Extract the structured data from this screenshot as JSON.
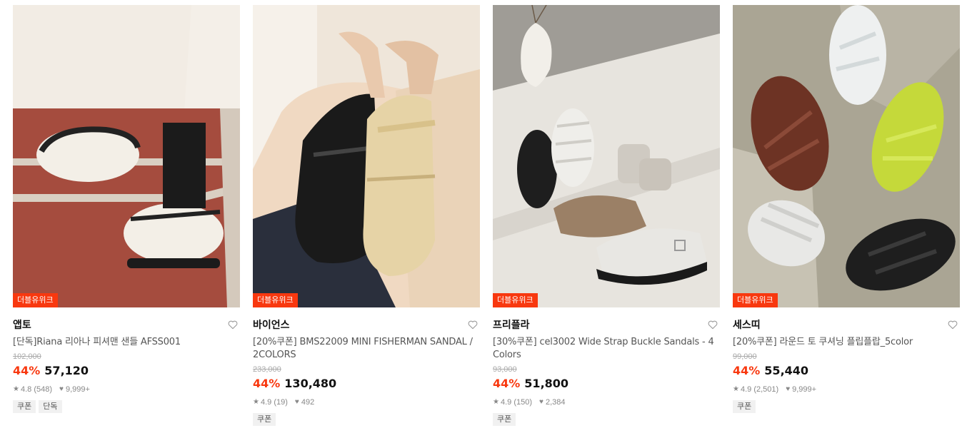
{
  "products": [
    {
      "badge": "더블유위크",
      "brand": "앱토",
      "name": "[단독]Riana 리아나 피셔맨 샌들 AFSS001",
      "original_price": "102,000",
      "discount": "44%",
      "price": "57,120",
      "rating": "4.8",
      "reviews": "(548)",
      "likes": "9,999+",
      "tags": [
        "쿠폰",
        "단독"
      ]
    },
    {
      "badge": "더블유위크",
      "brand": "바이언스",
      "name": "[20%쿠폰] BMS22009 MINI FISHERMAN SANDAL / 2COLORS",
      "original_price": "233,000",
      "discount": "44%",
      "price": "130,480",
      "rating": "4.9",
      "reviews": "(19)",
      "likes": "492",
      "tags": [
        "쿠폰"
      ]
    },
    {
      "badge": "더블유위크",
      "brand": "프리플라",
      "name": "[30%쿠폰] cel3002 Wide Strap Buckle Sandals - 4 Colors",
      "original_price": "93,000",
      "discount": "44%",
      "price": "51,800",
      "rating": "4.9",
      "reviews": "(150)",
      "likes": "2,384",
      "tags": [
        "쿠폰"
      ]
    },
    {
      "badge": "더블유위크",
      "brand": "세스띠",
      "name": "[20%쿠폰] 라운드 토 쿠셔닝 플립플랍_5color",
      "original_price": "99,000",
      "discount": "44%",
      "price": "55,440",
      "rating": "4.9",
      "reviews": "(2,501)",
      "likes": "9,999+",
      "tags": [
        "쿠폰"
      ]
    }
  ],
  "icons": {
    "wish": "heart-outline-icon",
    "rating": "star-icon",
    "likes": "heart-icon"
  },
  "colors": {
    "accent": "#f8380f",
    "tag_bg": "#f1f1f1"
  }
}
